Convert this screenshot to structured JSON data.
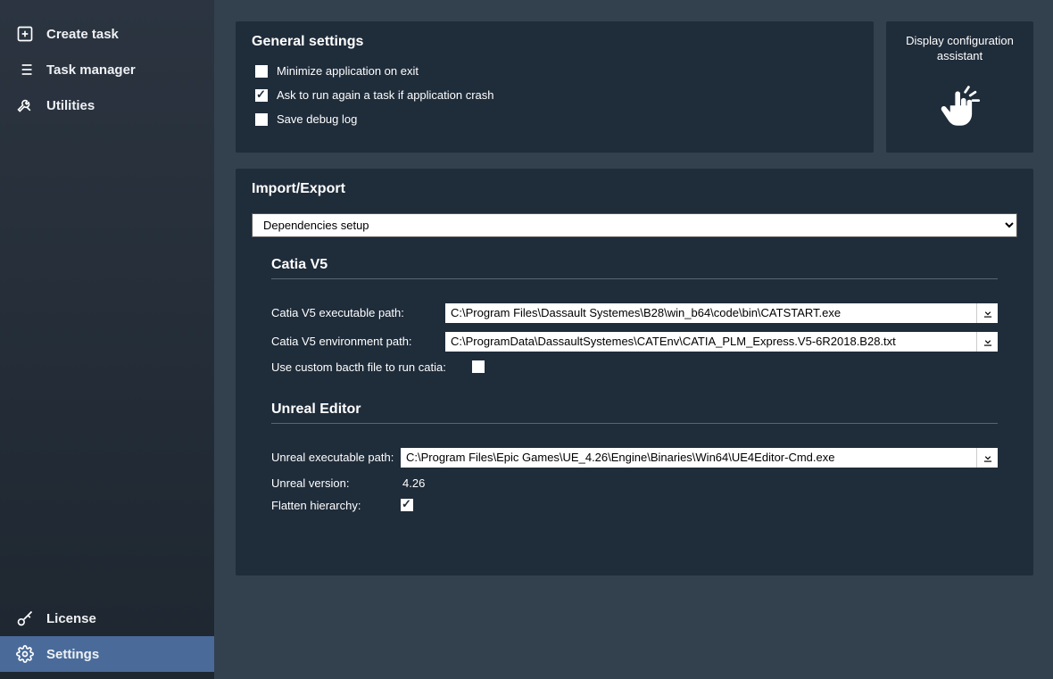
{
  "sidebar": {
    "top": [
      {
        "label": "Create task"
      },
      {
        "label": "Task manager"
      },
      {
        "label": "Utilities"
      }
    ],
    "bottom": [
      {
        "label": "License"
      },
      {
        "label": "Settings"
      }
    ]
  },
  "general": {
    "title": "General settings",
    "minimize_label": "Minimize application on exit",
    "minimize_checked": false,
    "askcrash_label": "Ask to run again a task if application crash",
    "askcrash_checked": true,
    "debug_label": "Save debug log",
    "debug_checked": false
  },
  "assistant": {
    "label": "Display configuration assistant"
  },
  "import": {
    "title": "Import/Export",
    "select_value": "Dependencies setup",
    "catia": {
      "title": "Catia V5",
      "exe_label": "Catia V5 executable path:",
      "exe_value": "C:\\Program Files\\Dassault Systemes\\B28\\win_b64\\code\\bin\\CATSTART.exe",
      "env_label": "Catia V5 environment path:",
      "env_value": "C:\\ProgramData\\DassaultSystemes\\CATEnv\\CATIA_PLM_Express.V5-6R2018.B28.txt",
      "batch_label": "Use custom bacth file to run catia:",
      "batch_checked": false
    },
    "unreal": {
      "title": "Unreal Editor",
      "exe_label": "Unreal executable path:",
      "exe_value": "C:\\Program Files\\Epic Games\\UE_4.26\\Engine\\Binaries\\Win64\\UE4Editor-Cmd.exe",
      "version_label": "Unreal version:",
      "version_value": "4.26",
      "flatten_label": "Flatten hierarchy:",
      "flatten_checked": true
    }
  }
}
